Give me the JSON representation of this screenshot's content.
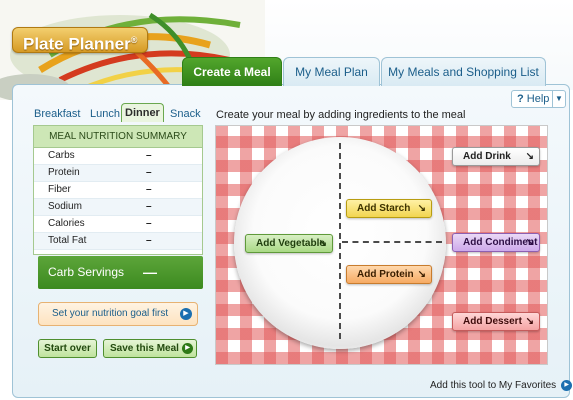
{
  "app": {
    "logo": "Plate Planner",
    "logo_mark": "®"
  },
  "tabs": [
    {
      "label": "Create a Meal",
      "active": true
    },
    {
      "label": "My Meal Plan",
      "active": false
    },
    {
      "label": "My Meals and Shopping List",
      "active": false
    }
  ],
  "help": {
    "icon": "?",
    "label": "Help",
    "dropdown_icon": "▼"
  },
  "meal_tabs": [
    {
      "label": "Breakfast",
      "active": false
    },
    {
      "label": "Lunch",
      "active": false
    },
    {
      "label": "Dinner",
      "active": true
    },
    {
      "label": "Snack",
      "active": false
    }
  ],
  "instruction": "Create your meal by adding ingredients to the meal",
  "nutrition": {
    "title": "MEAL NUTRITION SUMMARY",
    "rows": [
      {
        "label": "Carbs",
        "value": "–"
      },
      {
        "label": "Protein",
        "value": "–"
      },
      {
        "label": "Fiber",
        "value": "–"
      },
      {
        "label": "Sodium",
        "value": "–"
      },
      {
        "label": "Calories",
        "value": "–"
      },
      {
        "label": "Total Fat",
        "value": "–"
      }
    ]
  },
  "carb_servings": {
    "label": "Carb Servings",
    "value": "—"
  },
  "goal_link": {
    "label": "Set your nutrition goal first",
    "icon": "▶"
  },
  "buttons": {
    "start_over": "Start over",
    "save_meal": "Save this Meal",
    "save_icon": "▶"
  },
  "food_buttons": {
    "vegetable": "Add Vegetable",
    "starch": "Add Starch",
    "protein": "Add Protein",
    "drink": "Add Drink",
    "condiment": "Add Condiment",
    "dessert": "Add Dessert",
    "arrow": "↘"
  },
  "favorites": {
    "label": "Add this tool to My Favorites",
    "icon": "▶"
  },
  "colors": {
    "accent_green": "#3c8a1f",
    "link_blue": "#1b5e8a",
    "tablecloth_red": "#e25a5a"
  }
}
